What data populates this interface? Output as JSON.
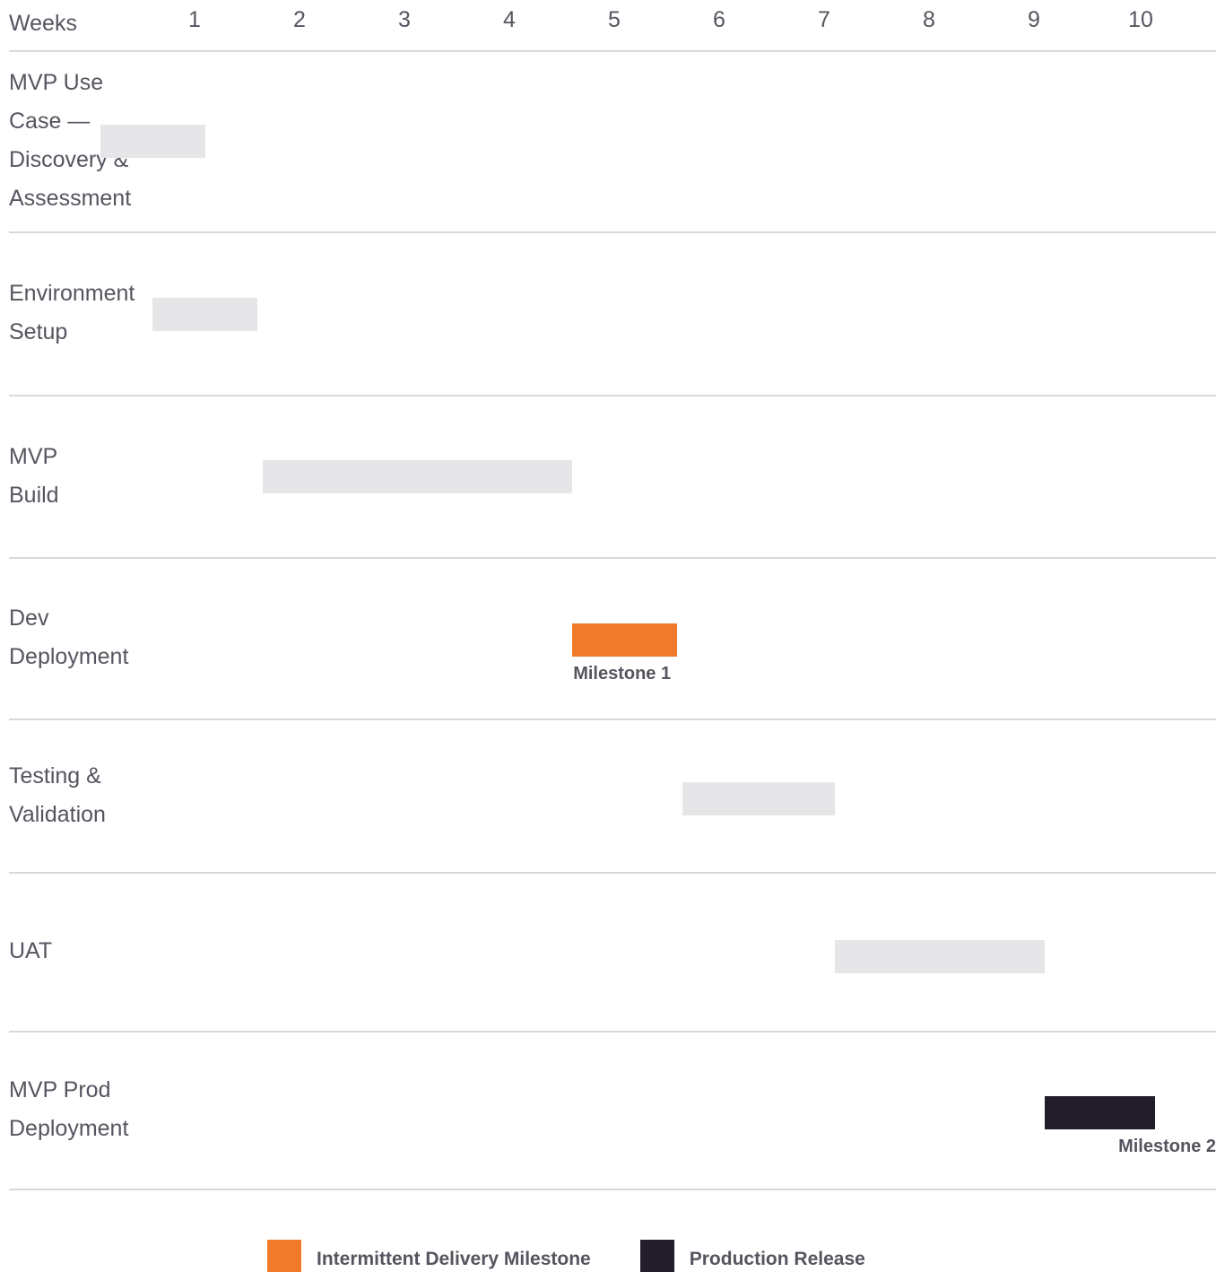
{
  "chart_data": {
    "type": "gantt",
    "x_header": "Weeks",
    "weeks": [
      "1",
      "2",
      "3",
      "4",
      "5",
      "6",
      "7",
      "8",
      "9",
      "10"
    ],
    "tasks": [
      {
        "name": "MVP Use Case — Discovery & Assessment",
        "lines": [
          "MVP Use",
          "Case —",
          "Discovery &",
          "Assessment"
        ],
        "start_week": 0.6,
        "end_week": 1.6,
        "kind": "phase"
      },
      {
        "name": "Environment Setup",
        "lines": [
          "Environment",
          "Setup"
        ],
        "start_week": 1.1,
        "end_week": 2.1,
        "kind": "phase"
      },
      {
        "name": "MVP Build",
        "lines": [
          "MVP",
          "Build"
        ],
        "start_week": 2.15,
        "end_week": 5.1,
        "kind": "phase"
      },
      {
        "name": "Dev Deployment",
        "lines": [
          "Dev",
          "Deployment"
        ],
        "start_week": 5.1,
        "end_week": 6.1,
        "kind": "milestone",
        "milestone_label": "Milestone 1"
      },
      {
        "name": "Testing & Validation",
        "lines": [
          "Testing &",
          "Validation"
        ],
        "start_week": 6.15,
        "end_week": 7.6,
        "kind": "phase"
      },
      {
        "name": "UAT",
        "lines": [
          "UAT"
        ],
        "start_week": 7.6,
        "end_week": 9.6,
        "kind": "phase"
      },
      {
        "name": "MVP Prod Deployment",
        "lines": [
          "MVP Prod",
          "Deployment"
        ],
        "start_week": 9.6,
        "end_week": 10.65,
        "kind": "release",
        "milestone_label": "Milestone 2"
      }
    ],
    "legend": [
      {
        "label": "Intermittent Delivery Milestone",
        "kind": "milestone"
      },
      {
        "label": "Production Release",
        "kind": "release"
      }
    ],
    "colors": {
      "phase": "#e6e6e8",
      "milestone": "#f07a2b",
      "release": "#211d2b",
      "divider": "#d9d9db",
      "text": "#55555f"
    },
    "grid": false
  }
}
